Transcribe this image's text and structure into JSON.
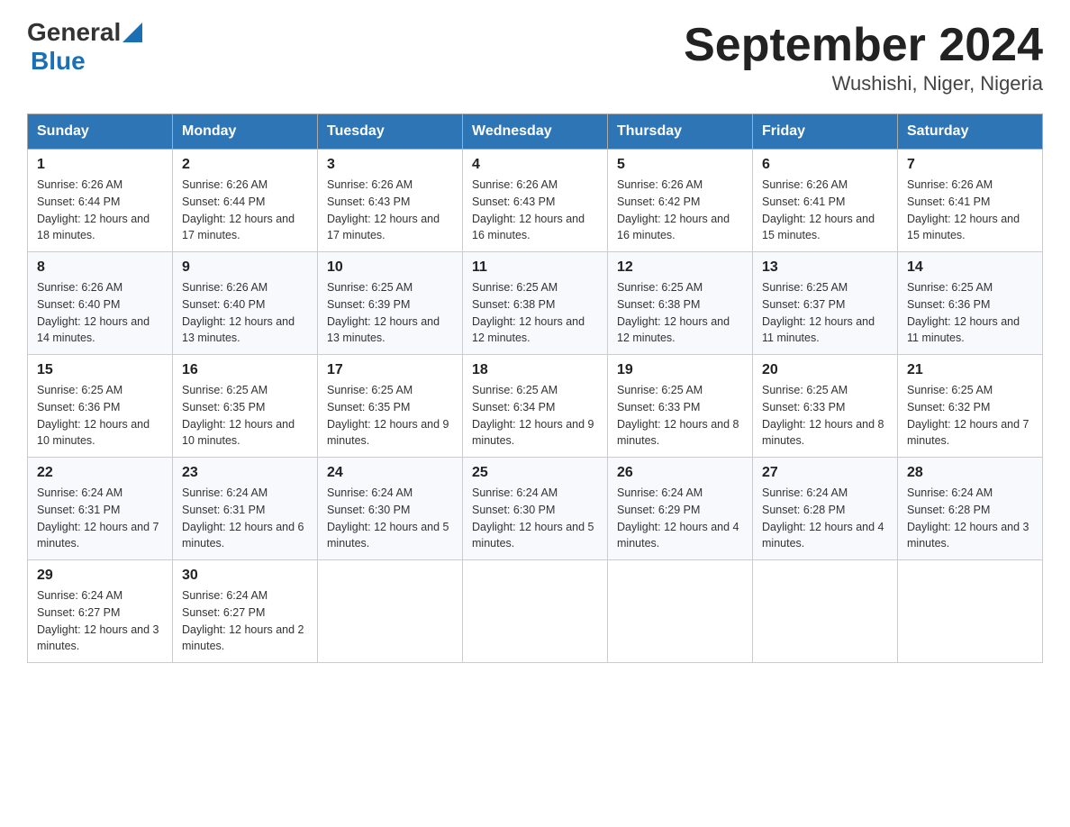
{
  "header": {
    "logo_general": "General",
    "logo_blue": "Blue",
    "title": "September 2024",
    "subtitle": "Wushishi, Niger, Nigeria"
  },
  "columns": [
    "Sunday",
    "Monday",
    "Tuesday",
    "Wednesday",
    "Thursday",
    "Friday",
    "Saturday"
  ],
  "weeks": [
    [
      {
        "day": "1",
        "sunrise": "6:26 AM",
        "sunset": "6:44 PM",
        "daylight": "12 hours and 18 minutes."
      },
      {
        "day": "2",
        "sunrise": "6:26 AM",
        "sunset": "6:44 PM",
        "daylight": "12 hours and 17 minutes."
      },
      {
        "day": "3",
        "sunrise": "6:26 AM",
        "sunset": "6:43 PM",
        "daylight": "12 hours and 17 minutes."
      },
      {
        "day": "4",
        "sunrise": "6:26 AM",
        "sunset": "6:43 PM",
        "daylight": "12 hours and 16 minutes."
      },
      {
        "day": "5",
        "sunrise": "6:26 AM",
        "sunset": "6:42 PM",
        "daylight": "12 hours and 16 minutes."
      },
      {
        "day": "6",
        "sunrise": "6:26 AM",
        "sunset": "6:41 PM",
        "daylight": "12 hours and 15 minutes."
      },
      {
        "day": "7",
        "sunrise": "6:26 AM",
        "sunset": "6:41 PM",
        "daylight": "12 hours and 15 minutes."
      }
    ],
    [
      {
        "day": "8",
        "sunrise": "6:26 AM",
        "sunset": "6:40 PM",
        "daylight": "12 hours and 14 minutes."
      },
      {
        "day": "9",
        "sunrise": "6:26 AM",
        "sunset": "6:40 PM",
        "daylight": "12 hours and 13 minutes."
      },
      {
        "day": "10",
        "sunrise": "6:25 AM",
        "sunset": "6:39 PM",
        "daylight": "12 hours and 13 minutes."
      },
      {
        "day": "11",
        "sunrise": "6:25 AM",
        "sunset": "6:38 PM",
        "daylight": "12 hours and 12 minutes."
      },
      {
        "day": "12",
        "sunrise": "6:25 AM",
        "sunset": "6:38 PM",
        "daylight": "12 hours and 12 minutes."
      },
      {
        "day": "13",
        "sunrise": "6:25 AM",
        "sunset": "6:37 PM",
        "daylight": "12 hours and 11 minutes."
      },
      {
        "day": "14",
        "sunrise": "6:25 AM",
        "sunset": "6:36 PM",
        "daylight": "12 hours and 11 minutes."
      }
    ],
    [
      {
        "day": "15",
        "sunrise": "6:25 AM",
        "sunset": "6:36 PM",
        "daylight": "12 hours and 10 minutes."
      },
      {
        "day": "16",
        "sunrise": "6:25 AM",
        "sunset": "6:35 PM",
        "daylight": "12 hours and 10 minutes."
      },
      {
        "day": "17",
        "sunrise": "6:25 AM",
        "sunset": "6:35 PM",
        "daylight": "12 hours and 9 minutes."
      },
      {
        "day": "18",
        "sunrise": "6:25 AM",
        "sunset": "6:34 PM",
        "daylight": "12 hours and 9 minutes."
      },
      {
        "day": "19",
        "sunrise": "6:25 AM",
        "sunset": "6:33 PM",
        "daylight": "12 hours and 8 minutes."
      },
      {
        "day": "20",
        "sunrise": "6:25 AM",
        "sunset": "6:33 PM",
        "daylight": "12 hours and 8 minutes."
      },
      {
        "day": "21",
        "sunrise": "6:25 AM",
        "sunset": "6:32 PM",
        "daylight": "12 hours and 7 minutes."
      }
    ],
    [
      {
        "day": "22",
        "sunrise": "6:24 AM",
        "sunset": "6:31 PM",
        "daylight": "12 hours and 7 minutes."
      },
      {
        "day": "23",
        "sunrise": "6:24 AM",
        "sunset": "6:31 PM",
        "daylight": "12 hours and 6 minutes."
      },
      {
        "day": "24",
        "sunrise": "6:24 AM",
        "sunset": "6:30 PM",
        "daylight": "12 hours and 5 minutes."
      },
      {
        "day": "25",
        "sunrise": "6:24 AM",
        "sunset": "6:30 PM",
        "daylight": "12 hours and 5 minutes."
      },
      {
        "day": "26",
        "sunrise": "6:24 AM",
        "sunset": "6:29 PM",
        "daylight": "12 hours and 4 minutes."
      },
      {
        "day": "27",
        "sunrise": "6:24 AM",
        "sunset": "6:28 PM",
        "daylight": "12 hours and 4 minutes."
      },
      {
        "day": "28",
        "sunrise": "6:24 AM",
        "sunset": "6:28 PM",
        "daylight": "12 hours and 3 minutes."
      }
    ],
    [
      {
        "day": "29",
        "sunrise": "6:24 AM",
        "sunset": "6:27 PM",
        "daylight": "12 hours and 3 minutes."
      },
      {
        "day": "30",
        "sunrise": "6:24 AM",
        "sunset": "6:27 PM",
        "daylight": "12 hours and 2 minutes."
      },
      null,
      null,
      null,
      null,
      null
    ]
  ]
}
